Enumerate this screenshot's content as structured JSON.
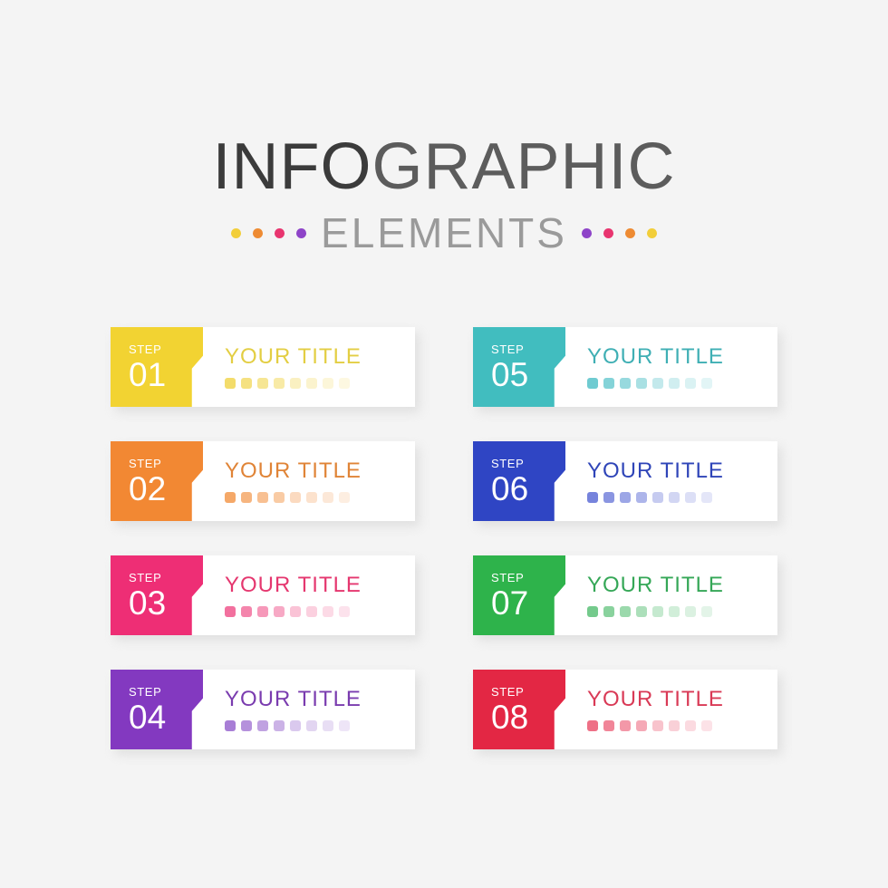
{
  "header": {
    "title_part1": "INFO",
    "title_part2": "GRAPHIC",
    "title_full": "INFOGRAPHIC",
    "subtitle": "ELEMENTS",
    "title_color": "#3b3b3b",
    "title_color_light": "#5c5c5c",
    "subtitle_color": "#9a9a9a",
    "dots_left": [
      "#F2CE3A",
      "#EE8B33",
      "#E8356F",
      "#8E44C8"
    ],
    "dots_right": [
      "#8E44C8",
      "#E8356F",
      "#EE8B33",
      "#F2CE3A"
    ]
  },
  "background_color": "#f4f4f4",
  "card_background": "#ffffff",
  "pip_opacities": [
    1,
    0.85,
    0.72,
    0.6,
    0.42,
    0.33,
    0.26,
    0.2
  ],
  "cards": [
    {
      "step_label": "STEP",
      "number": "01",
      "title": "YOUR TITLE",
      "color": "#F2D332",
      "title_color": "#E3CE43",
      "pip_color": "#F3DC6B"
    },
    {
      "step_label": "STEP",
      "number": "05",
      "title": "YOUR TITLE",
      "color": "#41BDBF",
      "title_color": "#3FAFB4",
      "pip_color": "#6FCBD1"
    },
    {
      "step_label": "STEP",
      "number": "02",
      "title": "YOUR TITLE",
      "color": "#F28833",
      "title_color": "#E08437",
      "pip_color": "#F5A868"
    },
    {
      "step_label": "STEP",
      "number": "06",
      "title": "YOUR TITLE",
      "color": "#2F45C4",
      "title_color": "#2F45B8",
      "pip_color": "#7683DC"
    },
    {
      "step_label": "STEP",
      "number": "03",
      "title": "YOUR TITLE",
      "color": "#EE2E75",
      "title_color": "#E5376F",
      "pip_color": "#F2709E"
    },
    {
      "step_label": "STEP",
      "number": "07",
      "title": "YOUR TITLE",
      "color": "#2EB34B",
      "title_color": "#35A757",
      "pip_color": "#74CA8C"
    },
    {
      "step_label": "STEP",
      "number": "04",
      "title": "YOUR TITLE",
      "color": "#8339C0",
      "title_color": "#7A3CAF",
      "pip_color": "#A87ED6"
    },
    {
      "step_label": "STEP",
      "number": "08",
      "title": "YOUR TITLE",
      "color": "#E32744",
      "title_color": "#D93A56",
      "pip_color": "#EE7086"
    }
  ]
}
